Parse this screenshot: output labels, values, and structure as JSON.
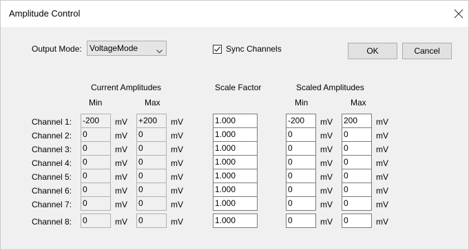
{
  "window": {
    "title": "Amplitude Control"
  },
  "output_mode": {
    "label": "Output Mode:",
    "value": "VoltageMode"
  },
  "sync": {
    "label": "Sync Channels",
    "checked": true
  },
  "buttons": {
    "ok": "OK",
    "cancel": "Cancel"
  },
  "headers": {
    "current": "Current Amplitudes",
    "scale": "Scale Factor",
    "scaled": "Scaled Amplitudes",
    "min": "Min",
    "max": "Max"
  },
  "unit": "mV",
  "channels": [
    {
      "label": "Channel 1:",
      "cur_min": "-200",
      "cur_max": "+200",
      "scale": "1.000",
      "sc_min": "-200",
      "sc_max": "200"
    },
    {
      "label": "Channel 2:",
      "cur_min": "0",
      "cur_max": "0",
      "scale": "1.000",
      "sc_min": "0",
      "sc_max": "0"
    },
    {
      "label": "Channel 3:",
      "cur_min": "0",
      "cur_max": "0",
      "scale": "1.000",
      "sc_min": "0",
      "sc_max": "0"
    },
    {
      "label": "Channel 4:",
      "cur_min": "0",
      "cur_max": "0",
      "scale": "1.000",
      "sc_min": "0",
      "sc_max": "0"
    },
    {
      "label": "Channel 5:",
      "cur_min": "0",
      "cur_max": "0",
      "scale": "1.000",
      "sc_min": "0",
      "sc_max": "0"
    },
    {
      "label": "Channel 6:",
      "cur_min": "0",
      "cur_max": "0",
      "scale": "1.000",
      "sc_min": "0",
      "sc_max": "0"
    },
    {
      "label": "Channel 7:",
      "cur_min": "0",
      "cur_max": "0",
      "scale": "1.000",
      "sc_min": "0",
      "sc_max": "0"
    },
    {
      "label": "Channel 8:",
      "cur_min": "0",
      "cur_max": "0",
      "scale": "1.000",
      "sc_min": "0",
      "sc_max": "0"
    }
  ]
}
